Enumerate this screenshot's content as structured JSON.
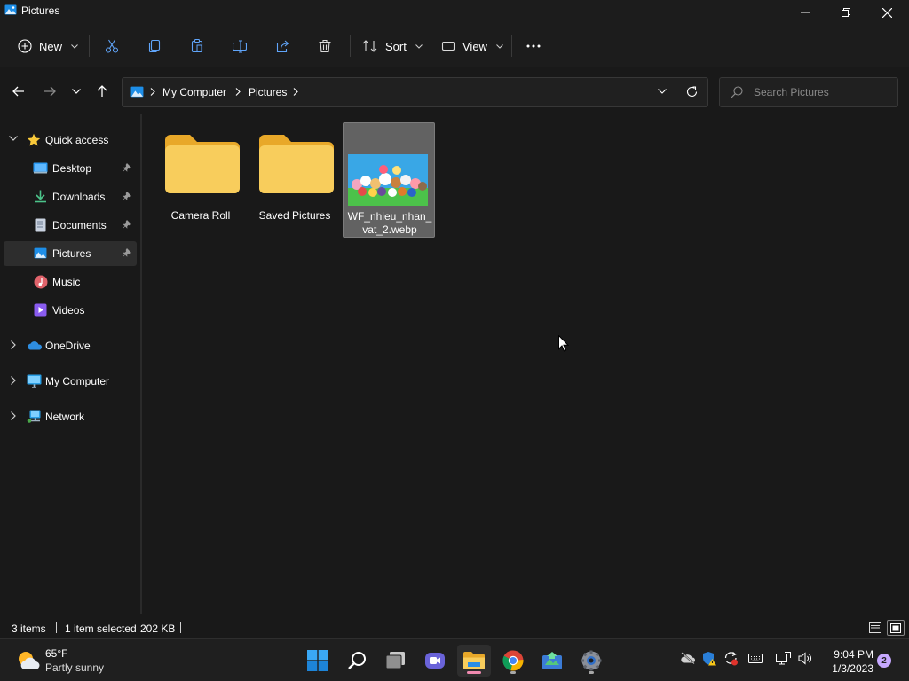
{
  "window": {
    "title": "Pictures",
    "app_icon": "pictures-app-icon"
  },
  "window_controls": [
    "minimize-icon",
    "restore-icon",
    "close-icon"
  ],
  "toolbar": {
    "new_label": "New",
    "sort_label": "Sort",
    "view_label": "View",
    "icons": [
      "cut-icon",
      "copy-icon",
      "paste-icon",
      "rename-icon",
      "share-icon",
      "delete-icon",
      "more-icon"
    ]
  },
  "address": {
    "breadcrumb": [
      "My Computer",
      "Pictures"
    ]
  },
  "search": {
    "placeholder": "Search Pictures"
  },
  "nav": {
    "quick_access": "Quick access",
    "items": [
      {
        "label": "Desktop",
        "icon": "desktop-icon",
        "pinned": true
      },
      {
        "label": "Downloads",
        "icon": "downloads-icon",
        "pinned": true
      },
      {
        "label": "Documents",
        "icon": "documents-icon",
        "pinned": true
      },
      {
        "label": "Pictures",
        "icon": "pictures-icon",
        "pinned": true,
        "selected": true
      },
      {
        "label": "Music",
        "icon": "music-icon",
        "pinned": false
      },
      {
        "label": "Videos",
        "icon": "videos-icon",
        "pinned": false
      }
    ],
    "roots": [
      {
        "label": "OneDrive",
        "icon": "onedrive-icon"
      },
      {
        "label": "My Computer",
        "icon": "computer-icon"
      },
      {
        "label": "Network",
        "icon": "network-icon"
      }
    ]
  },
  "files": [
    {
      "name": "Camera Roll",
      "type": "folder"
    },
    {
      "name": "Saved Pictures",
      "type": "folder"
    },
    {
      "name_line1": "WF_nhieu_nhan_",
      "name_line2": "vat_2.webp",
      "type": "image",
      "selected": true
    }
  ],
  "status": {
    "items_count": "3 items",
    "selection": "1 item selected",
    "size": "202 KB"
  },
  "taskbar": {
    "weather": {
      "temp": "65°F",
      "condition": "Partly sunny"
    },
    "apps": [
      "start-icon",
      "search-icon",
      "task-view-icon",
      "chat-icon",
      "file-explorer-icon",
      "chrome-icon",
      "app-icon",
      "settings-icon"
    ],
    "clock": {
      "time": "9:04 PM",
      "date": "1/3/2023"
    },
    "notifications": "2"
  },
  "colors": {
    "folder": "#f5c54c",
    "accent": "#0f6cbd",
    "background": "#191919"
  }
}
